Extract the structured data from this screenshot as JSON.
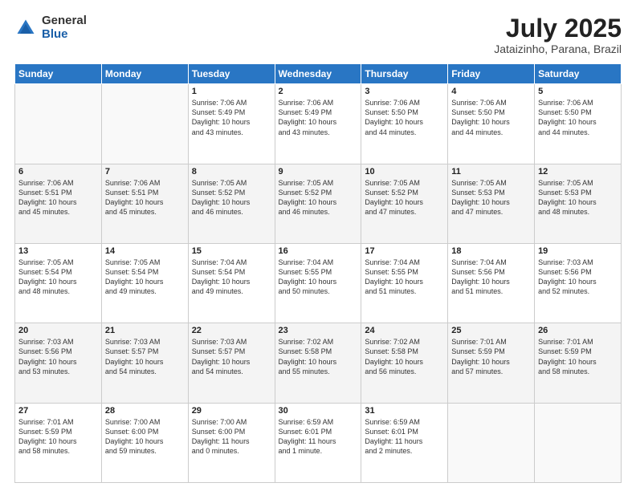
{
  "logo": {
    "general": "General",
    "blue": "Blue"
  },
  "title": "July 2025",
  "subtitle": "Jataizinho, Parana, Brazil",
  "headers": [
    "Sunday",
    "Monday",
    "Tuesday",
    "Wednesday",
    "Thursday",
    "Friday",
    "Saturday"
  ],
  "weeks": [
    [
      {
        "day": "",
        "info": ""
      },
      {
        "day": "",
        "info": ""
      },
      {
        "day": "1",
        "info": "Sunrise: 7:06 AM\nSunset: 5:49 PM\nDaylight: 10 hours\nand 43 minutes."
      },
      {
        "day": "2",
        "info": "Sunrise: 7:06 AM\nSunset: 5:49 PM\nDaylight: 10 hours\nand 43 minutes."
      },
      {
        "day": "3",
        "info": "Sunrise: 7:06 AM\nSunset: 5:50 PM\nDaylight: 10 hours\nand 44 minutes."
      },
      {
        "day": "4",
        "info": "Sunrise: 7:06 AM\nSunset: 5:50 PM\nDaylight: 10 hours\nand 44 minutes."
      },
      {
        "day": "5",
        "info": "Sunrise: 7:06 AM\nSunset: 5:50 PM\nDaylight: 10 hours\nand 44 minutes."
      }
    ],
    [
      {
        "day": "6",
        "info": "Sunrise: 7:06 AM\nSunset: 5:51 PM\nDaylight: 10 hours\nand 45 minutes."
      },
      {
        "day": "7",
        "info": "Sunrise: 7:06 AM\nSunset: 5:51 PM\nDaylight: 10 hours\nand 45 minutes."
      },
      {
        "day": "8",
        "info": "Sunrise: 7:05 AM\nSunset: 5:52 PM\nDaylight: 10 hours\nand 46 minutes."
      },
      {
        "day": "9",
        "info": "Sunrise: 7:05 AM\nSunset: 5:52 PM\nDaylight: 10 hours\nand 46 minutes."
      },
      {
        "day": "10",
        "info": "Sunrise: 7:05 AM\nSunset: 5:52 PM\nDaylight: 10 hours\nand 47 minutes."
      },
      {
        "day": "11",
        "info": "Sunrise: 7:05 AM\nSunset: 5:53 PM\nDaylight: 10 hours\nand 47 minutes."
      },
      {
        "day": "12",
        "info": "Sunrise: 7:05 AM\nSunset: 5:53 PM\nDaylight: 10 hours\nand 48 minutes."
      }
    ],
    [
      {
        "day": "13",
        "info": "Sunrise: 7:05 AM\nSunset: 5:54 PM\nDaylight: 10 hours\nand 48 minutes."
      },
      {
        "day": "14",
        "info": "Sunrise: 7:05 AM\nSunset: 5:54 PM\nDaylight: 10 hours\nand 49 minutes."
      },
      {
        "day": "15",
        "info": "Sunrise: 7:04 AM\nSunset: 5:54 PM\nDaylight: 10 hours\nand 49 minutes."
      },
      {
        "day": "16",
        "info": "Sunrise: 7:04 AM\nSunset: 5:55 PM\nDaylight: 10 hours\nand 50 minutes."
      },
      {
        "day": "17",
        "info": "Sunrise: 7:04 AM\nSunset: 5:55 PM\nDaylight: 10 hours\nand 51 minutes."
      },
      {
        "day": "18",
        "info": "Sunrise: 7:04 AM\nSunset: 5:56 PM\nDaylight: 10 hours\nand 51 minutes."
      },
      {
        "day": "19",
        "info": "Sunrise: 7:03 AM\nSunset: 5:56 PM\nDaylight: 10 hours\nand 52 minutes."
      }
    ],
    [
      {
        "day": "20",
        "info": "Sunrise: 7:03 AM\nSunset: 5:56 PM\nDaylight: 10 hours\nand 53 minutes."
      },
      {
        "day": "21",
        "info": "Sunrise: 7:03 AM\nSunset: 5:57 PM\nDaylight: 10 hours\nand 54 minutes."
      },
      {
        "day": "22",
        "info": "Sunrise: 7:03 AM\nSunset: 5:57 PM\nDaylight: 10 hours\nand 54 minutes."
      },
      {
        "day": "23",
        "info": "Sunrise: 7:02 AM\nSunset: 5:58 PM\nDaylight: 10 hours\nand 55 minutes."
      },
      {
        "day": "24",
        "info": "Sunrise: 7:02 AM\nSunset: 5:58 PM\nDaylight: 10 hours\nand 56 minutes."
      },
      {
        "day": "25",
        "info": "Sunrise: 7:01 AM\nSunset: 5:59 PM\nDaylight: 10 hours\nand 57 minutes."
      },
      {
        "day": "26",
        "info": "Sunrise: 7:01 AM\nSunset: 5:59 PM\nDaylight: 10 hours\nand 58 minutes."
      }
    ],
    [
      {
        "day": "27",
        "info": "Sunrise: 7:01 AM\nSunset: 5:59 PM\nDaylight: 10 hours\nand 58 minutes."
      },
      {
        "day": "28",
        "info": "Sunrise: 7:00 AM\nSunset: 6:00 PM\nDaylight: 10 hours\nand 59 minutes."
      },
      {
        "day": "29",
        "info": "Sunrise: 7:00 AM\nSunset: 6:00 PM\nDaylight: 11 hours\nand 0 minutes."
      },
      {
        "day": "30",
        "info": "Sunrise: 6:59 AM\nSunset: 6:01 PM\nDaylight: 11 hours\nand 1 minute."
      },
      {
        "day": "31",
        "info": "Sunrise: 6:59 AM\nSunset: 6:01 PM\nDaylight: 11 hours\nand 2 minutes."
      },
      {
        "day": "",
        "info": ""
      },
      {
        "day": "",
        "info": ""
      }
    ]
  ]
}
